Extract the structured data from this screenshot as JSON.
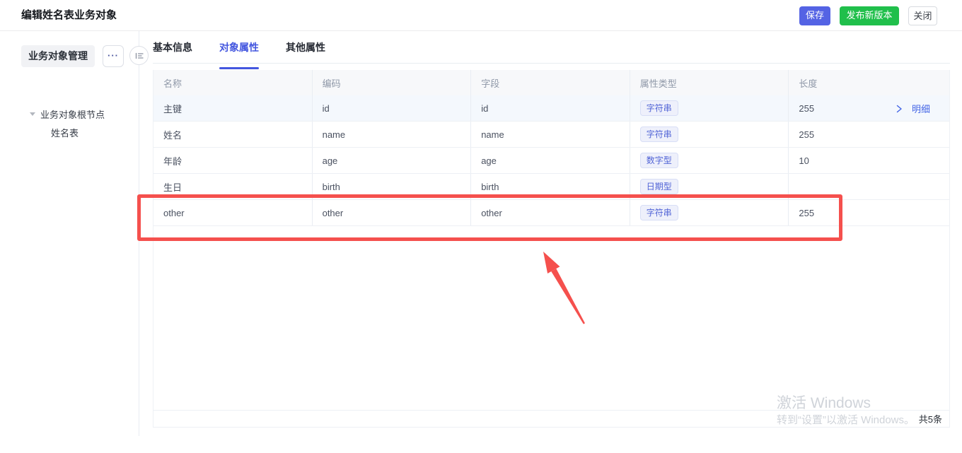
{
  "header": {
    "title": "编辑姓名表业务对象",
    "save_label": "保存",
    "publish_label": "发布新版本",
    "close_label": "关闭"
  },
  "sidebar": {
    "panel_title": "业务对象管理",
    "more_label": "···",
    "tree": {
      "root_label": "业务对象根节点",
      "child_label": "姓名表"
    }
  },
  "tabs": [
    {
      "label": "基本信息",
      "active": false
    },
    {
      "label": "对象属性",
      "active": true
    },
    {
      "label": "其他属性",
      "active": false
    }
  ],
  "table": {
    "columns": [
      "名称",
      "编码",
      "字段",
      "属性类型",
      "长度"
    ],
    "rows": [
      {
        "name": "主键",
        "code": "id",
        "field": "id",
        "type": "字符串",
        "length": "255",
        "detail": "明细"
      },
      {
        "name": "姓名",
        "code": "name",
        "field": "name",
        "type": "字符串",
        "length": "255"
      },
      {
        "name": "年龄",
        "code": "age",
        "field": "age",
        "type": "数字型",
        "length": "10"
      },
      {
        "name": "生日",
        "code": "birth",
        "field": "birth",
        "type": "日期型",
        "length": ""
      },
      {
        "name": "other",
        "code": "other",
        "field": "other",
        "type": "字符串",
        "length": "255"
      }
    ],
    "total_label": "共5条"
  },
  "watermark": {
    "line1": "激活 Windows",
    "line2": "转到“设置”以激活 Windows。"
  },
  "colors": {
    "accent_blue": "#5463e4",
    "accent_green": "#20bf4b",
    "tab_active": "#4356df",
    "badge_text": "#5063d6",
    "annotation_red": "#f5504d"
  }
}
